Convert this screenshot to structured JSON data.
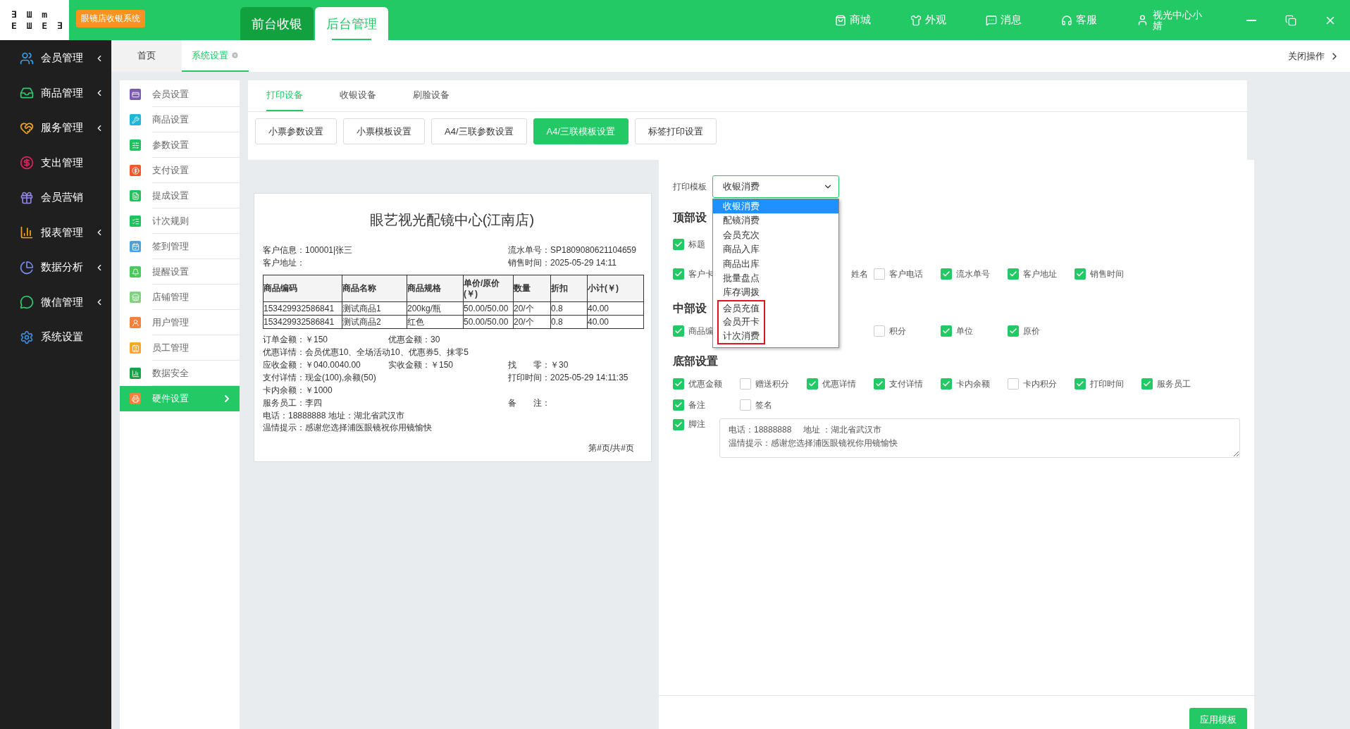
{
  "top_bar": {
    "logo_rows": [
      "∃ Ш m",
      "E Ш E ∃"
    ],
    "app_badge": "眼镜店收银系统",
    "modes": [
      {
        "label": "前台收银",
        "selected": false
      },
      {
        "label": "后台管理",
        "selected": true
      }
    ],
    "actions": [
      "商城",
      "外观",
      "消息",
      "客服"
    ],
    "user": "视光中心小婧"
  },
  "sidebar": {
    "items": [
      {
        "label": "会员管理",
        "color": "#3aa0e6",
        "expandable": true
      },
      {
        "label": "商品管理",
        "color": "#2ecc71",
        "expandable": true
      },
      {
        "label": "服务管理",
        "color": "#f5a623",
        "expandable": true
      },
      {
        "label": "支出管理",
        "color": "#e0245e",
        "expandable": false
      },
      {
        "label": "会员营销",
        "color": "#8f86e0",
        "expandable": false
      },
      {
        "label": "报表管理",
        "color": "#f5a623",
        "expandable": true
      },
      {
        "label": "数据分析",
        "color": "#7a8ff0",
        "expandable": true
      },
      {
        "label": "微信管理",
        "color": "#2ecc71",
        "expandable": true
      },
      {
        "label": "系统设置",
        "color": "#3a8fe6",
        "expandable": false
      }
    ]
  },
  "page_tabs": {
    "tabs": [
      {
        "label": "首页",
        "selected": false,
        "closable": false
      },
      {
        "label": "系统设置",
        "selected": true,
        "closable": true
      }
    ],
    "close_all": "关闭操作"
  },
  "settings_nav": [
    {
      "label": "会员设置",
      "color": "#7b5ea7",
      "selected": false
    },
    {
      "label": "商品设置",
      "color": "#1fb6d9",
      "selected": false
    },
    {
      "label": "参数设置",
      "color": "#21c25e",
      "selected": false
    },
    {
      "label": "支付设置",
      "color": "#f05a28",
      "selected": false
    },
    {
      "label": "提成设置",
      "color": "#21c25e",
      "selected": false
    },
    {
      "label": "计次规则",
      "color": "#21c25e",
      "selected": false
    },
    {
      "label": "签到管理",
      "color": "#4aa3df",
      "selected": false
    },
    {
      "label": "提醒设置",
      "color": "#47c95e",
      "selected": false
    },
    {
      "label": "店铺管理",
      "color": "#7ed37e",
      "selected": false
    },
    {
      "label": "用户管理",
      "color": "#f5813c",
      "selected": false
    },
    {
      "label": "员工管理",
      "color": "#f9a825",
      "selected": false
    },
    {
      "label": "数据安全",
      "color": "#17a34a",
      "selected": false
    },
    {
      "label": "硬件设置",
      "color": "#f5813c",
      "selected": true
    }
  ],
  "device_tabs": [
    {
      "label": "打印设备",
      "selected": true
    },
    {
      "label": "收银设备",
      "selected": false
    },
    {
      "label": "刷脸设备",
      "selected": false
    }
  ],
  "print_buttons": [
    {
      "label": "小票参数设置",
      "selected": false
    },
    {
      "label": "小票模板设置",
      "selected": false
    },
    {
      "label": "A4/三联参数设置",
      "selected": false
    },
    {
      "label": "A4/三联模板设置",
      "selected": true
    },
    {
      "label": "标签打印设置",
      "selected": false
    }
  ],
  "receipt": {
    "title": "眼艺视光配镜中心(江南店)",
    "header_lines": [
      {
        "left": "客户信息：100001|张三",
        "right": "流水单号：SP1809080621104659"
      },
      {
        "left": "客户地址：",
        "right": "销售时间：2025-05-29 14:11"
      }
    ],
    "table": {
      "columns": [
        "商品编码",
        "商品名称",
        "商品规格",
        "单价/原价(￥)",
        "数量",
        "折扣",
        "小计(￥)"
      ],
      "rows": [
        [
          "153429932586841",
          "测试商品1",
          "200kg/瓶",
          "50.00/50.00",
          "20/个",
          "0.8",
          "40.00"
        ],
        [
          "153429932586841",
          "测试商品2",
          "红色",
          "50.00/50.00",
          "20/个",
          "0.8",
          "40.00"
        ]
      ]
    },
    "footer_lines": [
      {
        "left": "订单金额：￥150",
        "middle": "优惠金额：30"
      },
      {
        "wide": "优惠详情：会员优惠10、全场活动10、优惠券5、抹零5"
      },
      {
        "left": "应收金额：￥040.0040.00",
        "middle": "实收金额：￥150",
        "right": "找　　零：￥30"
      },
      {
        "left": "支付详情：现金(100),余额(50)",
        "right": "打印时间：2025-05-29 14:11:35"
      },
      {
        "left": "卡内余额：￥1000"
      },
      {
        "left": "服务员工：李四",
        "right": "备　　注："
      }
    ],
    "notes": [
      "电话：18888888 地址：湖北省武汉市",
      "温情提示：感谢您选择浦医眼镜祝你用镜愉快"
    ],
    "page_number": "第#页/共#页"
  },
  "template": {
    "label": "打印模板",
    "value": "收银消费",
    "options": [
      {
        "label": "收银消费",
        "selected": true,
        "marked": false
      },
      {
        "label": "配镜消费",
        "selected": false,
        "marked": false
      },
      {
        "label": "会员充次",
        "selected": false,
        "marked": false
      },
      {
        "label": "商品入库",
        "selected": false,
        "marked": false
      },
      {
        "label": "商品出库",
        "selected": false,
        "marked": false
      },
      {
        "label": "批量盘点",
        "selected": false,
        "marked": false
      },
      {
        "label": "库存调拨",
        "selected": false,
        "marked": false
      },
      {
        "label": "会员充值",
        "selected": false,
        "marked": true
      },
      {
        "label": "会员开卡",
        "selected": false,
        "marked": true
      },
      {
        "label": "计次消费",
        "selected": false,
        "marked": true
      }
    ]
  },
  "sections": [
    {
      "heading": "顶部设",
      "rows": [
        [
          {
            "kind": "checkbox",
            "label": "标题",
            "checked": true
          }
        ],
        [
          {
            "kind": "checkbox",
            "label": "客户卡",
            "checked": true
          },
          {
            "kind": "covered"
          },
          {
            "kind": "tail",
            "label": "姓名"
          },
          {
            "kind": "checkbox",
            "label": "客户电话",
            "checked": false
          },
          {
            "kind": "checkbox",
            "label": "流水单号",
            "checked": true
          },
          {
            "kind": "checkbox",
            "label": "客户地址",
            "checked": true
          },
          {
            "kind": "checkbox",
            "label": "销售时间",
            "checked": true
          }
        ]
      ]
    },
    {
      "heading": "中部设",
      "rows": [
        [
          {
            "kind": "checkbox",
            "label": "商品编",
            "checked": true
          },
          {
            "kind": "covered"
          },
          {
            "kind": "covered"
          },
          {
            "kind": "checkbox",
            "label": "积分",
            "checked": false
          },
          {
            "kind": "checkbox",
            "label": "单位",
            "checked": true
          },
          {
            "kind": "checkbox",
            "label": "原价",
            "checked": true
          }
        ]
      ]
    },
    {
      "heading": "底部设置",
      "rows": [
        [
          {
            "kind": "checkbox",
            "label": "优惠金额",
            "checked": true
          },
          {
            "kind": "checkbox",
            "label": "赠送积分",
            "checked": false
          },
          {
            "kind": "checkbox",
            "label": "优惠详情",
            "checked": true
          },
          {
            "kind": "checkbox",
            "label": "支付详情",
            "checked": true
          },
          {
            "kind": "checkbox",
            "label": "卡内余额",
            "checked": true
          },
          {
            "kind": "checkbox",
            "label": "卡内积分",
            "checked": false
          },
          {
            "kind": "checkbox",
            "label": "打印时间",
            "checked": true
          },
          {
            "kind": "checkbox",
            "label": "服务员工",
            "checked": true
          }
        ],
        [
          {
            "kind": "checkbox",
            "label": "备注",
            "checked": true
          },
          {
            "kind": "checkbox",
            "label": "签名",
            "checked": false
          }
        ]
      ]
    }
  ],
  "footnote": {
    "label": "脚注",
    "checked": true,
    "lines": [
      "电话：18888888     地址 ：湖北省武汉市",
      "温情提示：感谢您选择浦医眼镜祝你用镜愉快"
    ]
  },
  "apply_button": "应用模板"
}
